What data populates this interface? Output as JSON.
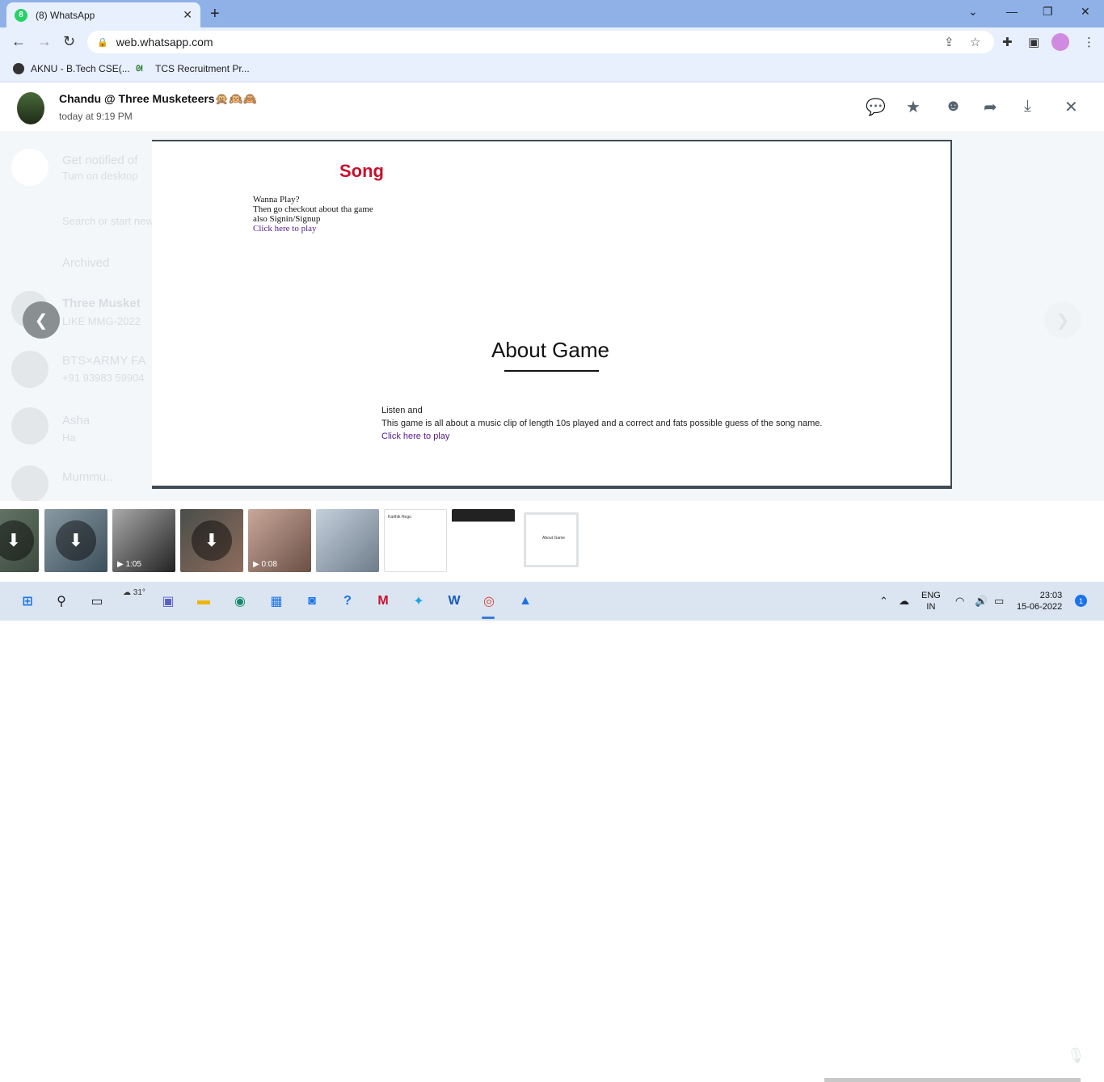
{
  "browser": {
    "tab_title": "(8) WhatsApp",
    "tab_badge": "8",
    "url": "web.whatsapp.com",
    "bookmarks": [
      "AKNU - B.Tech CSE(...",
      "TCS Recruitment Pr..."
    ]
  },
  "viewer": {
    "sender": "Chandu @ Three Musketeers",
    "sender_emoji": "🙊🙉🙈",
    "timestamp": "today at 9:19 PM"
  },
  "image_content": {
    "song_title": "Song",
    "intro_lines": [
      "Wanna Play?",
      "Then go checkout about tha game",
      "also Signin/Signup"
    ],
    "intro_link": "Click here to play",
    "about_title": "About Game",
    "about_lines": [
      "Listen and",
      "This game is all about a music clip of length 10s played and a correct and fats possible guess of the song name."
    ],
    "about_link": "Click here to play"
  },
  "background_chats": [
    {
      "name": "Get notified of",
      "preview": "Turn on desktop"
    },
    {
      "name": "Search or start new chat",
      "preview": ""
    },
    {
      "name": "Archived",
      "preview": ""
    },
    {
      "name": "Three Musket",
      "preview": "LIKE MMG-2022"
    },
    {
      "name": "BTS×ARMY FA",
      "preview": "+91 93983 59904"
    },
    {
      "name": "Asha",
      "preview": "Ha"
    },
    {
      "name": "Mummu..",
      "preview": ""
    }
  ],
  "thumbnails": [
    {
      "kind": "image-download",
      "duration": ""
    },
    {
      "kind": "image-download",
      "duration": ""
    },
    {
      "kind": "video",
      "duration": "1:05"
    },
    {
      "kind": "image-download",
      "duration": ""
    },
    {
      "kind": "video",
      "duration": "0:08"
    },
    {
      "kind": "image",
      "duration": ""
    },
    {
      "kind": "document",
      "duration": "",
      "text": "Karthik Regu"
    },
    {
      "kind": "image",
      "duration": ""
    },
    {
      "kind": "image-selected",
      "duration": "",
      "text": "About Game"
    }
  ],
  "taskbar": {
    "temperature": "31°",
    "lang_line1": "ENG",
    "lang_line2": "IN",
    "time": "23:03",
    "date": "15-06-2022",
    "notifications": "1"
  },
  "colors": {
    "tabbar": "#8fb1e8",
    "song_title": "#c8102e",
    "link": "#551a8b",
    "whatsapp_green": "#25d366"
  }
}
